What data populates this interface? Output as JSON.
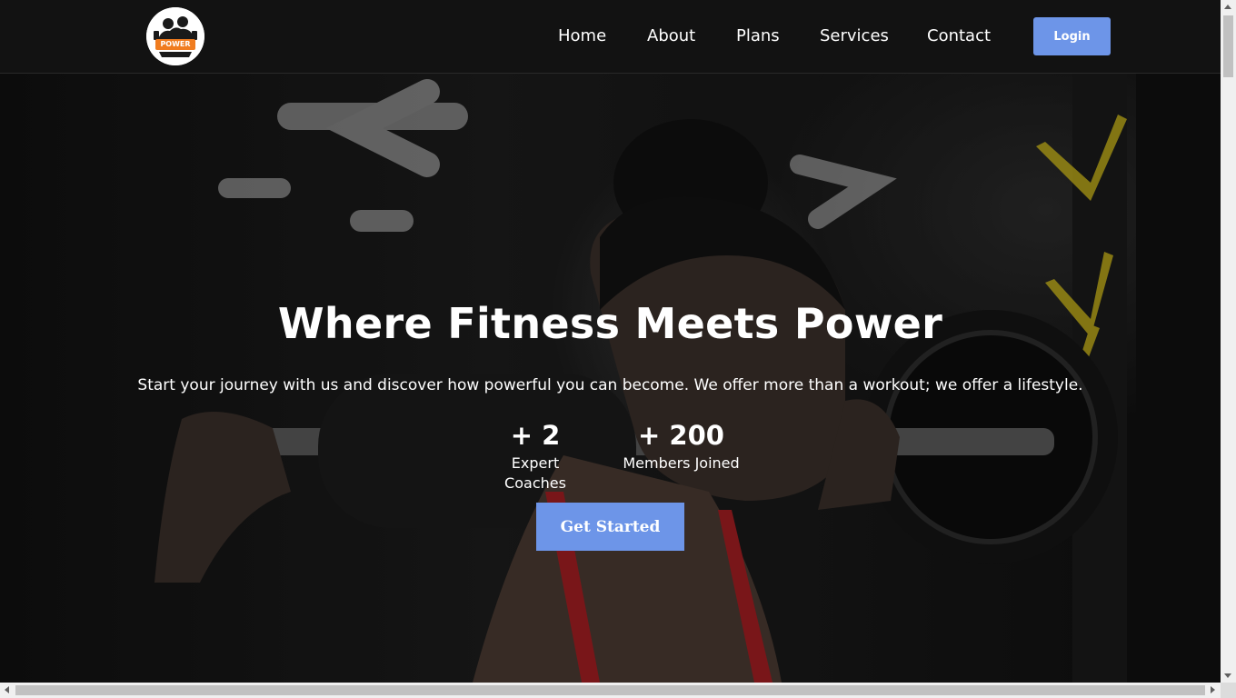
{
  "nav": {
    "logo_text": "POWER",
    "links": [
      "Home",
      "About",
      "Plans",
      "Services",
      "Contact"
    ],
    "login_label": "Login"
  },
  "hero": {
    "title": "Where Fitness Meets Power",
    "subtitle": "Start your journey with us and discover how powerful you can become. We offer more than a workout; we offer a lifestyle.",
    "stats": [
      {
        "value": "+ 2",
        "label": "Expert Coaches"
      },
      {
        "value": "+ 200",
        "label": "Members Joined"
      }
    ],
    "cta_label": "Get Started"
  },
  "colors": {
    "accent": "#6d95e8",
    "navbar": "#121212",
    "logo_orange": "#f07c1f"
  }
}
